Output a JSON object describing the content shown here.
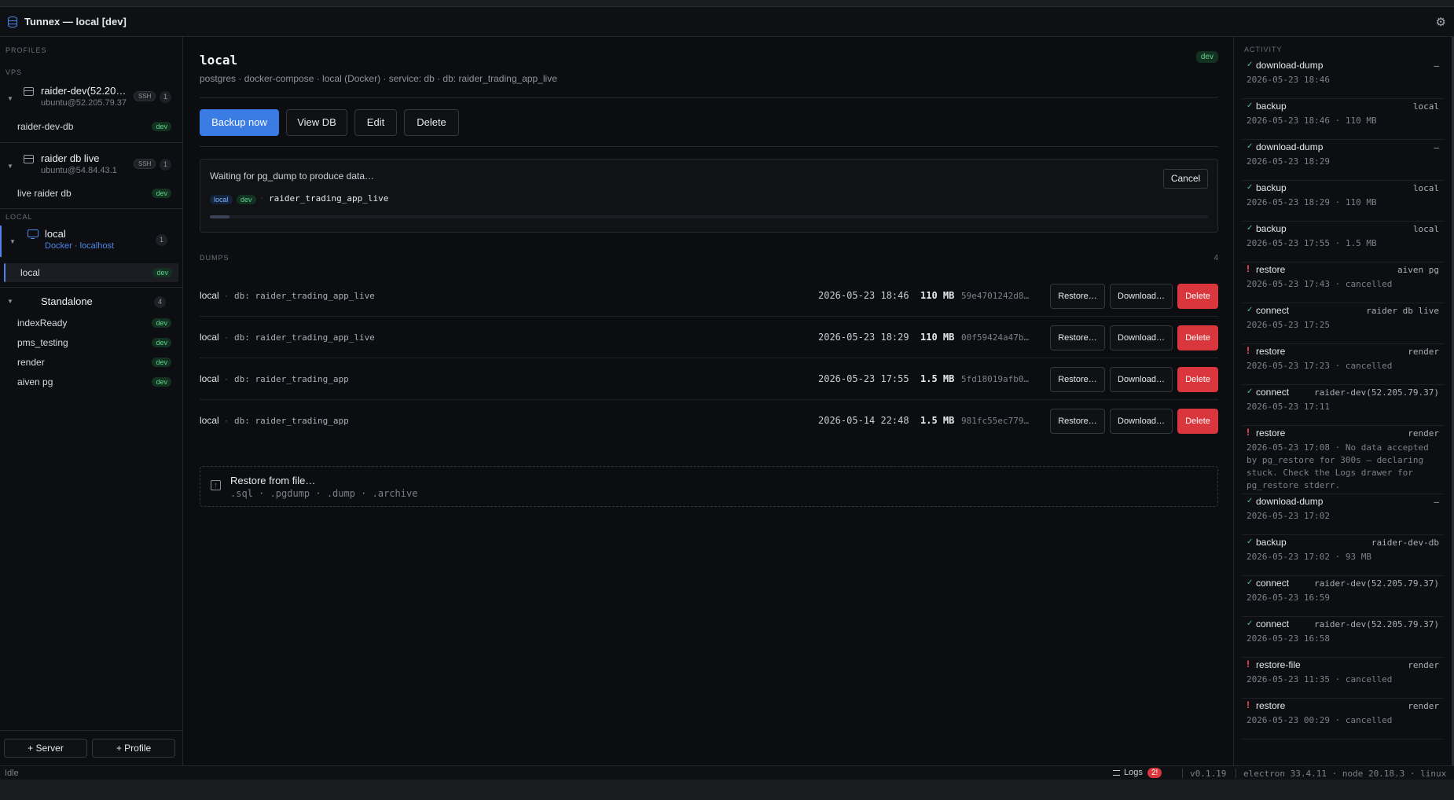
{
  "window": {
    "title": "Tunnex — local [dev]"
  },
  "sidebar": {
    "profiles_label": "PROFILES",
    "vps_label": "VPS",
    "local_label": "LOCAL",
    "servers": [
      {
        "name": "raider-dev(52.205.79.37)",
        "sub": "ubuntu@52.205.79.37",
        "conn": "SSH",
        "count": "1",
        "dbs": [
          {
            "name": "raider-dev-db",
            "tag": "dev"
          }
        ]
      },
      {
        "name": "raider db live",
        "sub": "ubuntu@54.84.43.1",
        "conn": "SSH",
        "count": "1",
        "dbs": [
          {
            "name": "live raider db",
            "tag": "dev"
          }
        ]
      }
    ],
    "local": {
      "name": "local",
      "sub": "Docker · localhost",
      "count": "1",
      "dbs": [
        {
          "name": "local",
          "tag": "dev"
        }
      ]
    },
    "standalone": {
      "name": "Standalone",
      "count": "4",
      "dbs": [
        {
          "name": "indexReady",
          "tag": "dev"
        },
        {
          "name": "pms_testing",
          "tag": "dev"
        },
        {
          "name": "render",
          "tag": "dev"
        },
        {
          "name": "aiven pg",
          "tag": "dev"
        }
      ]
    },
    "add_server": "+ Server",
    "add_profile": "+ Profile"
  },
  "main": {
    "title": "local",
    "subtitle": "postgres · docker-compose · local (Docker) · service: db · db: raider_trading_app_live",
    "env_tag": "dev",
    "actions": {
      "backup": "Backup now",
      "view": "View DB",
      "edit": "Edit",
      "delete": "Delete"
    },
    "progress": {
      "message": "Waiting for pg_dump to produce data…",
      "cancel": "Cancel",
      "chip_local": "local",
      "chip_dev": "dev",
      "sep": "·",
      "db": "raider_trading_app_live",
      "fraction": 0.02
    },
    "dumps_label": "DUMPS",
    "dumps_count": "4",
    "dumps": [
      {
        "src": "local",
        "db": "db: raider_trading_app_live",
        "ts": "2026-05-23 18:46",
        "size": "110 MB",
        "hash": "59e4701242d8…",
        "restore": "Restore…",
        "download": "Download…",
        "delete": "Delete"
      },
      {
        "src": "local",
        "db": "db: raider_trading_app_live",
        "ts": "2026-05-23 18:29",
        "size": "110 MB",
        "hash": "00f59424a47b…",
        "restore": "Restore…",
        "download": "Download…",
        "delete": "Delete"
      },
      {
        "src": "local",
        "db": "db: raider_trading_app",
        "ts": "2026-05-23 17:55",
        "size": "1.5 MB",
        "hash": "5fd18019afb0…",
        "restore": "Restore…",
        "download": "Download…",
        "delete": "Delete"
      },
      {
        "src": "local",
        "db": "db: raider_trading_app",
        "ts": "2026-05-14 22:48",
        "size": "1.5 MB",
        "hash": "981fc55ec779…",
        "restore": "Restore…",
        "download": "Download…",
        "delete": "Delete"
      }
    ],
    "dot": "·",
    "restore_file": {
      "title": "Restore from file…",
      "types": ".sql · .pgdump · .dump · .archive"
    }
  },
  "activity": {
    "label": "ACTIVITY",
    "items": [
      {
        "status": "ok",
        "op": "download-dump",
        "target": "—",
        "meta": "2026-05-23 18:46"
      },
      {
        "status": "ok",
        "op": "backup",
        "target": "local",
        "meta": "2026-05-23 18:46 · 110 MB"
      },
      {
        "status": "ok",
        "op": "download-dump",
        "target": "—",
        "meta": "2026-05-23 18:29"
      },
      {
        "status": "ok",
        "op": "backup",
        "target": "local",
        "meta": "2026-05-23 18:29 · 110 MB"
      },
      {
        "status": "ok",
        "op": "backup",
        "target": "local",
        "meta": "2026-05-23 17:55 · 1.5 MB"
      },
      {
        "status": "err",
        "op": "restore",
        "target": "aiven pg",
        "meta": "2026-05-23 17:43 · cancelled"
      },
      {
        "status": "ok",
        "op": "connect",
        "target": "raider db live",
        "meta": "2026-05-23 17:25"
      },
      {
        "status": "err",
        "op": "restore",
        "target": "render",
        "meta": "2026-05-23 17:23 · cancelled"
      },
      {
        "status": "ok",
        "op": "connect",
        "target": "raider-dev(52.205.79.37)",
        "meta": "2026-05-23 17:11"
      },
      {
        "status": "err",
        "op": "restore",
        "target": "render",
        "meta": "2026-05-23 17:08 · No data accepted by pg_restore for 300s — declaring stuck. Check the Logs drawer for pg_restore stderr."
      },
      {
        "status": "ok",
        "op": "download-dump",
        "target": "—",
        "meta": "2026-05-23 17:02"
      },
      {
        "status": "ok",
        "op": "backup",
        "target": "raider-dev-db",
        "meta": "2026-05-23 17:02 · 93 MB"
      },
      {
        "status": "ok",
        "op": "connect",
        "target": "raider-dev(52.205.79.37)",
        "meta": "2026-05-23 16:59"
      },
      {
        "status": "ok",
        "op": "connect",
        "target": "raider-dev(52.205.79.37)",
        "meta": "2026-05-23 16:58"
      },
      {
        "status": "err",
        "op": "restore-file",
        "target": "render",
        "meta": "2026-05-23 11:35 · cancelled"
      },
      {
        "status": "err",
        "op": "restore",
        "target": "render",
        "meta": "2026-05-23 00:29 · cancelled"
      }
    ]
  },
  "statusbar": {
    "state": "Idle",
    "logs": "Logs",
    "logs_badge": "2!",
    "version": "v0.1.19",
    "env": "electron 33.4.11 · node 20.18.3 · linux"
  }
}
